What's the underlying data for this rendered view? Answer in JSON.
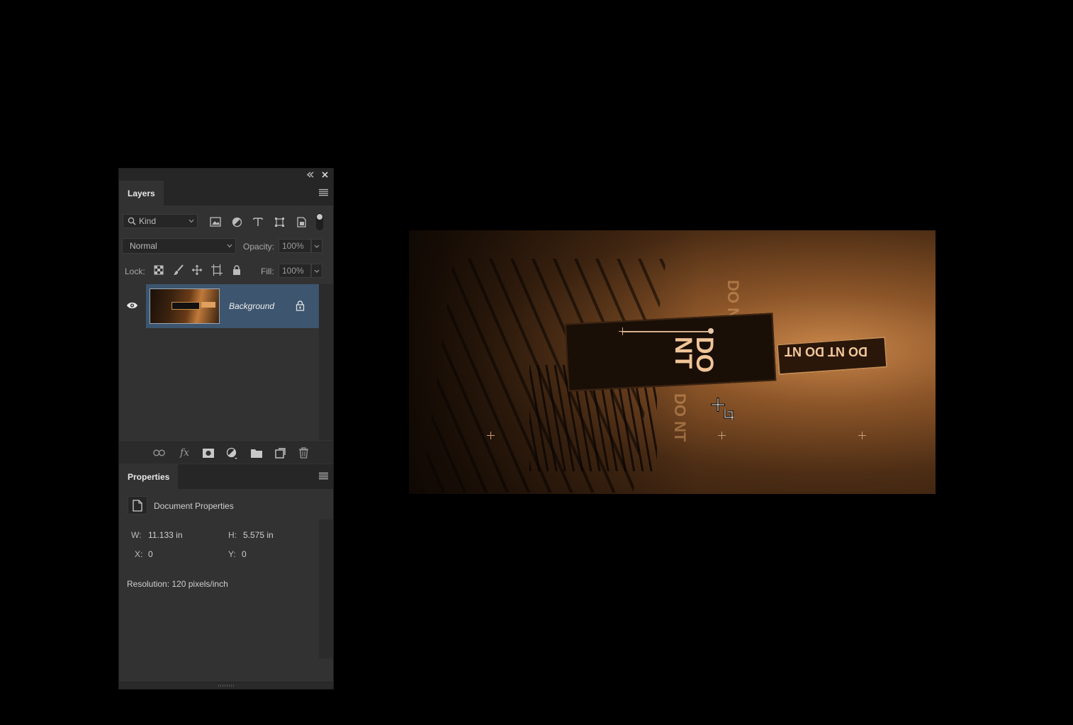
{
  "colors": {
    "panel_bg": "#323232",
    "panel_dark": "#262626",
    "selection": "#3d556f",
    "canvas_tone": "#8a5428"
  },
  "panel_controls": {
    "collapse_icon": "double-chevron-left-icon",
    "close_icon": "close-icon"
  },
  "layers_panel": {
    "tab_label": "Layers",
    "menu_icon": "panel-menu-icon",
    "filter": {
      "kind_label": "Kind",
      "icons": [
        "pixel-layer-filter-icon",
        "adjustment-layer-filter-icon",
        "type-layer-filter-icon",
        "shape-layer-filter-icon",
        "smart-object-filter-icon"
      ],
      "toggle": "on"
    },
    "blend_mode": "Normal",
    "opacity_label": "Opacity:",
    "opacity_value": "100%",
    "lock_label": "Lock:",
    "lock_icons": [
      "lock-transparent-icon",
      "lock-image-icon",
      "lock-position-icon",
      "lock-artboard-icon",
      "lock-all-icon"
    ],
    "fill_label": "Fill:",
    "fill_value": "100%",
    "layers": [
      {
        "name": "Background",
        "visible": true,
        "locked": true,
        "selected": true
      }
    ],
    "footer_icons": [
      "link-layers-icon",
      "fx-icon",
      "layer-mask-icon",
      "adjustment-icon",
      "group-folder-icon",
      "new-layer-icon",
      "trash-icon"
    ],
    "fx_label": "fx"
  },
  "properties_panel": {
    "tab_label": "Properties",
    "section_title": "Document Properties",
    "w_label": "W:",
    "w_value": "11.133 in",
    "h_label": "H:",
    "h_value": "5.575 in",
    "x_label": "X:",
    "x_value": "0",
    "y_label": "Y:",
    "y_value": "0",
    "resolution": "Resolution: 120 pixels/inch"
  },
  "canvas": {
    "sign_text": "DO\nNT",
    "sign2_text": "DO NT DO NT",
    "ghost_text": "DO\nNT",
    "cursor": "crop-cursor-icon"
  }
}
